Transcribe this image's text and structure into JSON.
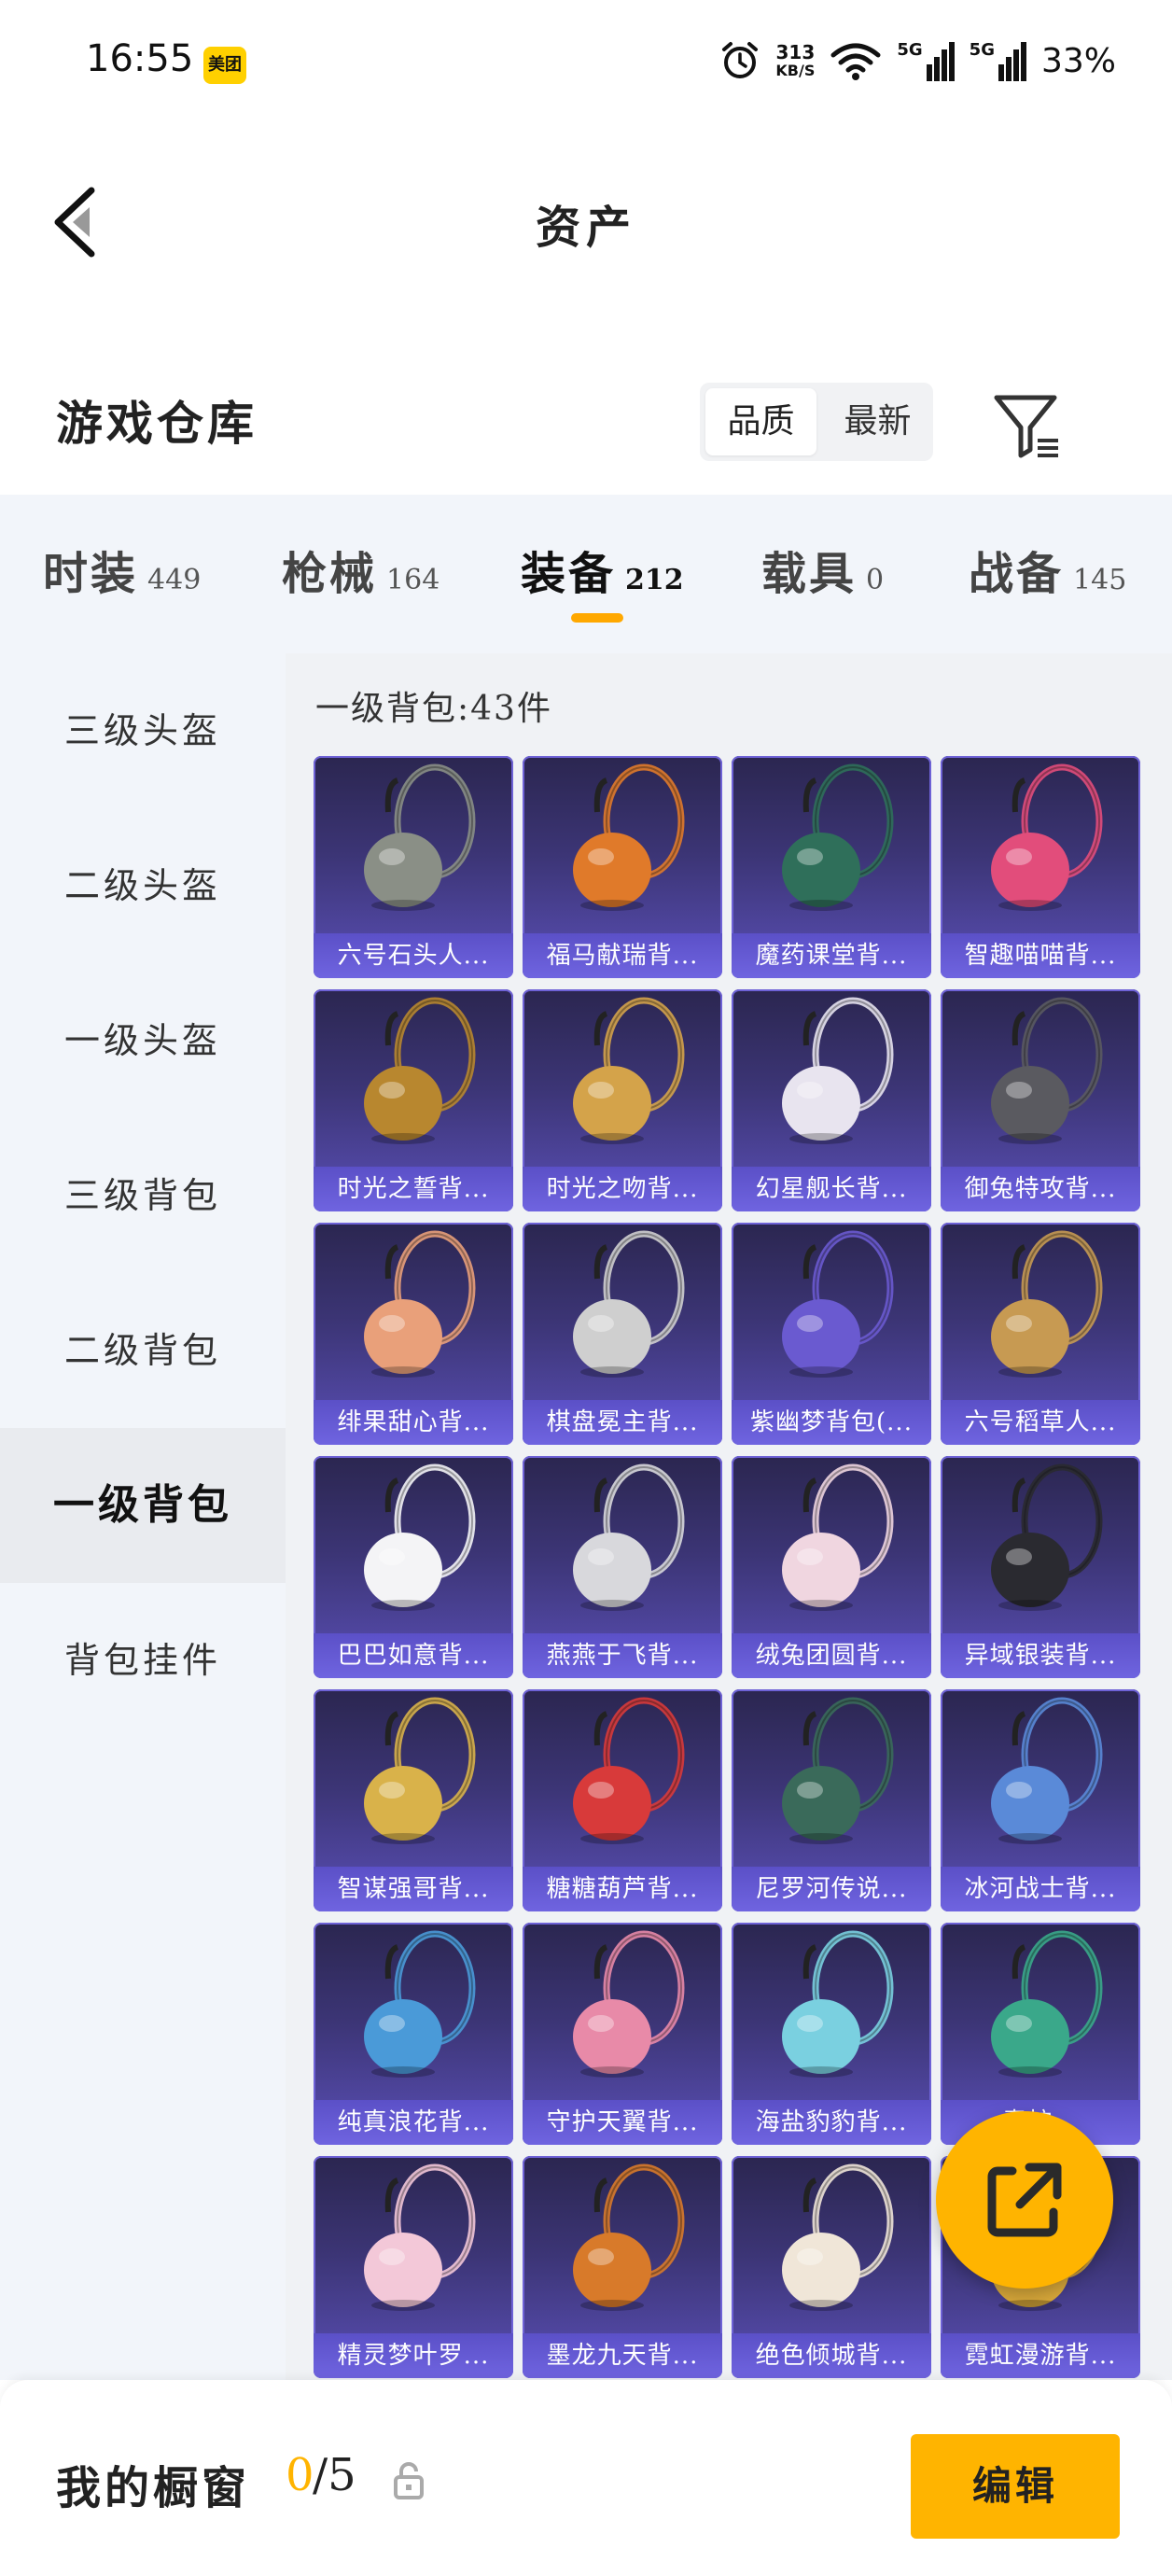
{
  "status_bar": {
    "time": "16:55",
    "app_badge": "美团",
    "net_speed_value": "313",
    "net_speed_unit": "KB/S",
    "signal1_tag": "5G",
    "signal2_tag": "5G",
    "battery": "33%",
    "icons": [
      "alarm-icon",
      "wifi-icon",
      "signal-icon",
      "signal-icon"
    ]
  },
  "header": {
    "title": "资产",
    "back_icon": "chevron-left-icon"
  },
  "warehouse": {
    "heading": "游戏仓库",
    "sort_options": [
      "品质",
      "最新"
    ],
    "sort_selected": "品质",
    "filter_icon": "filter-icon"
  },
  "tabs": [
    {
      "label": "时装",
      "count": "449"
    },
    {
      "label": "枪械",
      "count": "164"
    },
    {
      "label": "装备",
      "count": "212",
      "active": true
    },
    {
      "label": "载具",
      "count": "0"
    },
    {
      "label": "战备",
      "count": "145"
    }
  ],
  "sidebar": [
    {
      "label": "三级头盔"
    },
    {
      "label": "二级头盔"
    },
    {
      "label": "一级头盔"
    },
    {
      "label": "三级背包"
    },
    {
      "label": "二级背包"
    },
    {
      "label": "一级背包",
      "active": true
    },
    {
      "label": "背包挂件"
    }
  ],
  "content": {
    "count_text": "一级背包:43件",
    "items": [
      {
        "name": "六号石头人...",
        "color": "#8a8f86"
      },
      {
        "name": "福马献瑞背...",
        "color": "#e07a2a"
      },
      {
        "name": "魔药课堂背...",
        "color": "#2f6f5a"
      },
      {
        "name": "智趣喵喵背...",
        "color": "#e24d7b"
      },
      {
        "name": "时光之誓背...",
        "color": "#b8872f"
      },
      {
        "name": "时光之吻背...",
        "color": "#d4a34a"
      },
      {
        "name": "幻星舰长背...",
        "color": "#e8e4ef"
      },
      {
        "name": "御兔特攻背...",
        "color": "#5a5a60"
      },
      {
        "name": "绯果甜心背...",
        "color": "#e9a07a"
      },
      {
        "name": "棋盘冕主背...",
        "color": "#cfcfcf"
      },
      {
        "name": "紫幽梦背包(...",
        "color": "#6a5ad0"
      },
      {
        "name": "六号稻草人...",
        "color": "#c79a52"
      },
      {
        "name": "巴巴如意背...",
        "color": "#f4f4f6"
      },
      {
        "name": "燕燕于飞背...",
        "color": "#d8d8dc"
      },
      {
        "name": "绒兔团圆背...",
        "color": "#f0d6e0"
      },
      {
        "name": "异域银装背...",
        "color": "#2a2a30"
      },
      {
        "name": "智谋强哥背...",
        "color": "#d9b24a"
      },
      {
        "name": "糖糖葫芦背...",
        "color": "#d83a3a"
      },
      {
        "name": "尼罗河传说...",
        "color": "#3a6a5a"
      },
      {
        "name": "冰河战士背...",
        "color": "#5a8ad8"
      },
      {
        "name": "纯真浪花背...",
        "color": "#4a9ad8"
      },
      {
        "name": "守护天翼背...",
        "color": "#e88aa8"
      },
      {
        "name": "海盐豹豹背...",
        "color": "#7ad0e0"
      },
      {
        "name": "青柠...",
        "color": "#3aa88a"
      },
      {
        "name": "精灵梦叶罗...",
        "color": "#f3c8d8"
      },
      {
        "name": "墨龙九天背...",
        "color": "#d87a2a"
      },
      {
        "name": "绝色倾城背...",
        "color": "#f0e6d8"
      },
      {
        "name": "霓虹漫游背...",
        "color": "#d8a83a"
      }
    ]
  },
  "fab_icon": "share-external-icon",
  "bottom": {
    "label": "我的橱窗",
    "used": "0",
    "total": "/5",
    "lock_icon": "lock-icon",
    "edit_label": "编辑"
  }
}
